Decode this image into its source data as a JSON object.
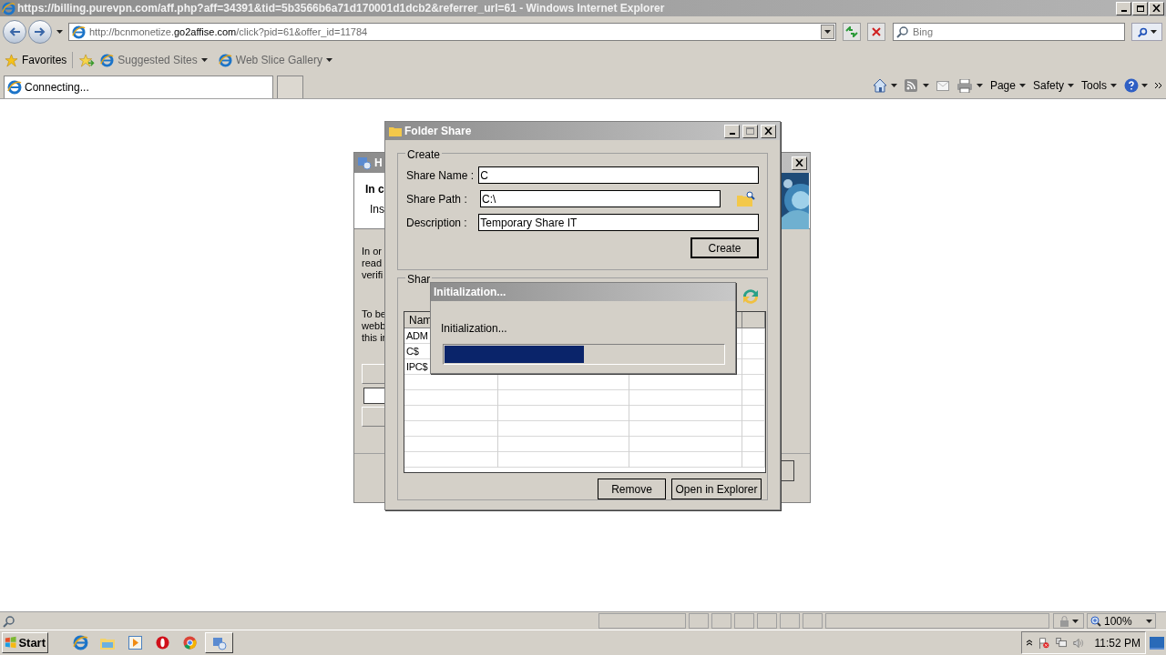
{
  "browser": {
    "title": "https://billing.purevpn.com/aff.php?aff=34391&tid=5b3566b6a71d170001d1dcb2&referrer_url=61 - Windows Internet Explorer",
    "address": {
      "prefix": "http://bcnmonetize.",
      "domain": "go2affise.com",
      "rest": "/click?pid=61&offer_id=11784"
    },
    "search_placeholder": "Bing",
    "favorites": "Favorites",
    "links": [
      "Suggested Sites",
      "Web Slice Gallery"
    ],
    "tabs": [
      {
        "label": "Connecting...",
        "selected": true
      }
    ],
    "commands": [
      "Page",
      "Safety",
      "Tools"
    ],
    "zoom": "100%"
  },
  "background_window": {
    "title": "H",
    "heading": "In c",
    "subheading": "Ins",
    "paragraph_1": [
      "In or",
      "read",
      "verifi"
    ],
    "paragraph_2": [
      "To be",
      "webb",
      "this ir"
    ]
  },
  "folder_share": {
    "title": "Folder Share",
    "create_group": "Create",
    "fields": [
      {
        "label": "Share Name :",
        "value": "C",
        "browse": false
      },
      {
        "label": "Share Path :",
        "value": "C:\\",
        "browse": true
      },
      {
        "label": "Description :",
        "value": "Temporary Share IT",
        "browse": false
      }
    ],
    "create_button": "Create",
    "shared_group": "Shar",
    "columns": [
      "Nam"
    ],
    "rows": [
      "ADM",
      "C$",
      "IPC$"
    ],
    "buttons": [
      "Remove",
      "Open in Explorer"
    ]
  },
  "progress_dialog": {
    "title": "Initialization...",
    "message": "Initialization...",
    "level": 0.5
  },
  "taskbar": {
    "start": "Start",
    "clock": "11:52 PM"
  }
}
